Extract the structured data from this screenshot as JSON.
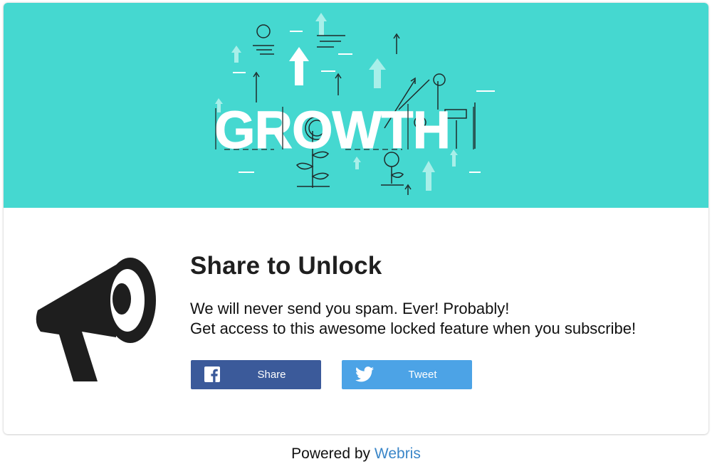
{
  "banner": {
    "word": "GROWTH",
    "background_color": "#45d8d0"
  },
  "content": {
    "title": "Share to Unlock",
    "description_line1": "We will never send you spam. Ever! Probably!",
    "description_line2": "Get access to this awesome locked feature when you subscribe!",
    "icon": "megaphone-icon"
  },
  "buttons": {
    "facebook": {
      "label": "Share",
      "icon": "facebook-icon",
      "color": "#3b5a9a"
    },
    "twitter": {
      "label": "Tweet",
      "icon": "twitter-icon",
      "color": "#4ca3e6"
    }
  },
  "footer": {
    "prefix": "Powered by",
    "brand": "Webris",
    "brand_color": "#3a86c8"
  }
}
